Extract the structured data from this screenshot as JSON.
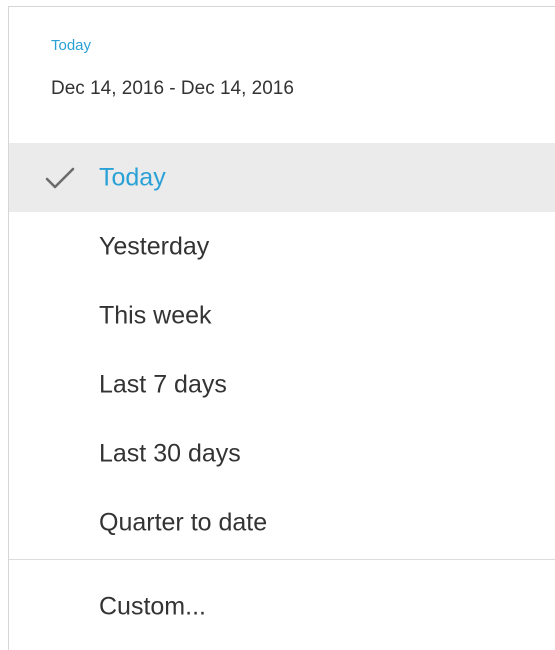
{
  "header": {
    "title": "Today",
    "date_range": "Dec 14, 2016 - Dec 14, 2016"
  },
  "menu": {
    "items": [
      {
        "label": "Today",
        "selected": true
      },
      {
        "label": "Yesterday",
        "selected": false
      },
      {
        "label": "This week",
        "selected": false
      },
      {
        "label": "Last 7 days",
        "selected": false
      },
      {
        "label": "Last 30 days",
        "selected": false
      },
      {
        "label": "Quarter to date",
        "selected": false
      }
    ],
    "custom_label": "Custom..."
  },
  "icons": {
    "selected_marker": "checkmark-icon"
  },
  "colors": {
    "accent": "#2aa1d6",
    "text": "#333333",
    "selected_background": "#ebebeb",
    "divider": "#dcdcdc"
  }
}
